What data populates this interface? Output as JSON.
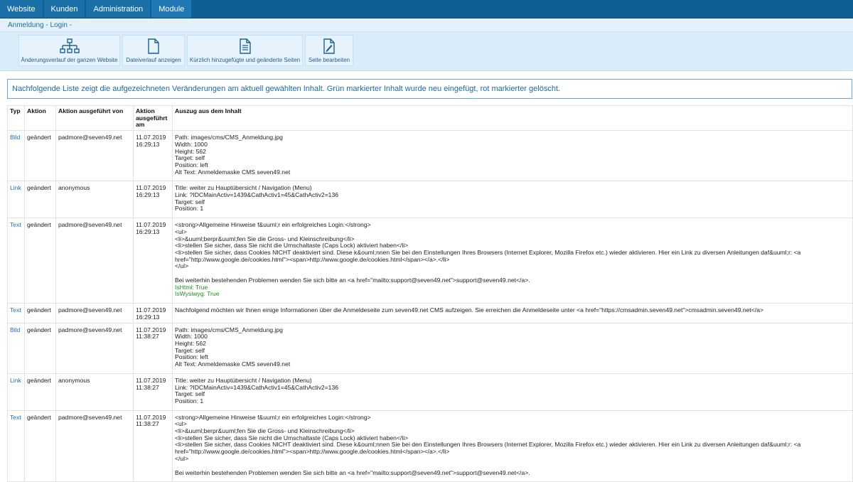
{
  "nav": {
    "tabs": [
      "Website",
      "Kunden",
      "Administration",
      "Module"
    ]
  },
  "breadcrumb": "Anmeldung - Login -",
  "toolbar": {
    "buttons": [
      {
        "label": "Änderungsverlauf der ganzen Website",
        "icon": "sitemap-icon"
      },
      {
        "label": "Dateiverlauf anzeigen",
        "icon": "file-icon"
      },
      {
        "label": "Kürzlich hinzugefügte und geänderte Seiten",
        "icon": "document-lines-icon"
      },
      {
        "label": "Seite bearbeiten",
        "icon": "edit-page-icon"
      }
    ]
  },
  "info": "Nachfolgende Liste zeigt die aufgezeichneten Veränderungen am aktuell gewählten Inhalt. Grün markierter Inhalt wurde neu eingefügt, rot markierter gelöscht.",
  "table": {
    "headers": {
      "typ": "Typ",
      "aktion": "Aktion",
      "von": "Aktion ausgeführt von",
      "am": "Aktion ausgeführt am",
      "auszug": "Auszug aus dem Inhalt"
    },
    "rows": [
      {
        "typ": "Bild",
        "aktion": "geändert",
        "von": "padmore@seven49.net",
        "date": "11.07.2019",
        "time": "16:29:13",
        "lines": [
          "Path: images/cms/CMS_Anmeldung.jpg",
          "Width: 1000",
          "Height: 562",
          "Target: self",
          "Position: left",
          "Alt Text: Anmeldemaske CMS seven49.net"
        ],
        "green": []
      },
      {
        "typ": "Link",
        "aktion": "geändert",
        "von": "anonymous",
        "date": "11.07.2019",
        "time": "16:29:13",
        "lines": [
          "Title: weiter zu Hauptübersicht / Navigation (Menu)",
          "Link: ?IDCMainActiv=1439&CathActiv1=45&CathActiv2=136",
          "Target: self",
          "Position: 1"
        ],
        "green": []
      },
      {
        "typ": "Text",
        "aktion": "geändert",
        "von": "padmore@seven49.net",
        "date": "11.07.2019",
        "time": "16:29:13",
        "lines": [
          "<strong>Allgemeine Hinweise f&uuml;r ein erfolgreiches Login:</strong>",
          "<ul>",
          "<li>&uuml;berpr&uuml;fen Sie die Gross- und Kleinschreibung</li>",
          "<li>stellen Sie sicher, dass Sie nicht die Umschaltaste (Caps Lock) aktiviert haben</li>",
          "<li>stellen Sie sicher, dass Cookies NICHT deaktiviert sind. Diese k&ouml;nnen Sie bei den Einstellungen Ihres Browsers (Internet Explorer, Mozilla Firefox etc.) wieder aktivieren. Hier ein Link zu diversen Anleitungen daf&uuml;r: <a href=\"http://www.google.de/cookies.html\"><span>http://www.google.de/cookies.html</span></a>.</li>",
          "</ul>",
          "",
          "Bei weiterhin bestehenden Problemen wenden Sie sich bitte an <a href=\"mailto:support@seven49.net\">support@seven49.net</a>."
        ],
        "green": [
          "IsHtml: True",
          "IsWysiwyg: True"
        ]
      },
      {
        "typ": "Text",
        "aktion": "geändert",
        "von": "padmore@seven49.net",
        "date": "11.07.2019",
        "time": "16:29:13",
        "lines": [
          "Nachfolgend möchten wir Ihnen einige Informationen über die Anmeldeseite zum seven49.net CMS aufzeigen. Sie erreichen die Anmeldeseite unter <a href=\"https://cmsadmin.seven49.net\">cmsadmin.seven49.net</a>"
        ],
        "green": []
      },
      {
        "typ": "Bild",
        "aktion": "geändert",
        "von": "padmore@seven49.net",
        "date": "11.07.2019",
        "time": "11:38:27",
        "lines": [
          "Path: images/cms/CMS_Anmeldung.jpg",
          "Width: 1000",
          "Height: 562",
          "Target: self",
          "Position: left",
          "Alt Text: Anmeldemaske CMS seven49.net"
        ],
        "green": []
      },
      {
        "typ": "Link",
        "aktion": "geändert",
        "von": "anonymous",
        "date": "11.07.2019",
        "time": "11:38:27",
        "lines": [
          "Title: weiter zu Hauptübersicht / Navigation (Menu)",
          "Link: ?IDCMainActiv=1439&CathActiv1=45&CathActiv2=136",
          "Target: self",
          "Position: 1"
        ],
        "green": []
      },
      {
        "typ": "Text",
        "aktion": "geändert",
        "von": "padmore@seven49.net",
        "date": "11.07.2019",
        "time": "11:38:27",
        "lines": [
          "<strong>Allgemeine Hinweise f&uuml;r ein erfolgreiches Login:</strong>",
          "<ul>",
          "<li>&uuml;berpr&uuml;fen Sie die Gross- und Kleinschreibung</li>",
          "<li>stellen Sie sicher, dass Sie nicht die Umschaltaste (Caps Lock) aktiviert haben</li>",
          "<li>stellen Sie sicher, dass Cookies NICHT deaktiviert sind. Diese k&ouml;nnen Sie bei den Einstellungen Ihres Browsers (Internet Explorer, Mozilla Firefox etc.) wieder aktivieren. Hier ein Link zu diversen Anleitungen daf&uuml;r: <a href=\"http://www.google.de/cookies.html\"><span>http://www.google.de/cookies.html</span></a>.</li>",
          "</ul>",
          "",
          "Bei weiterhin bestehenden Problemen wenden Sie sich bitte an <a href=\"mailto:support@seven49.net\">support@seven49.net</a>."
        ],
        "green": []
      }
    ]
  }
}
